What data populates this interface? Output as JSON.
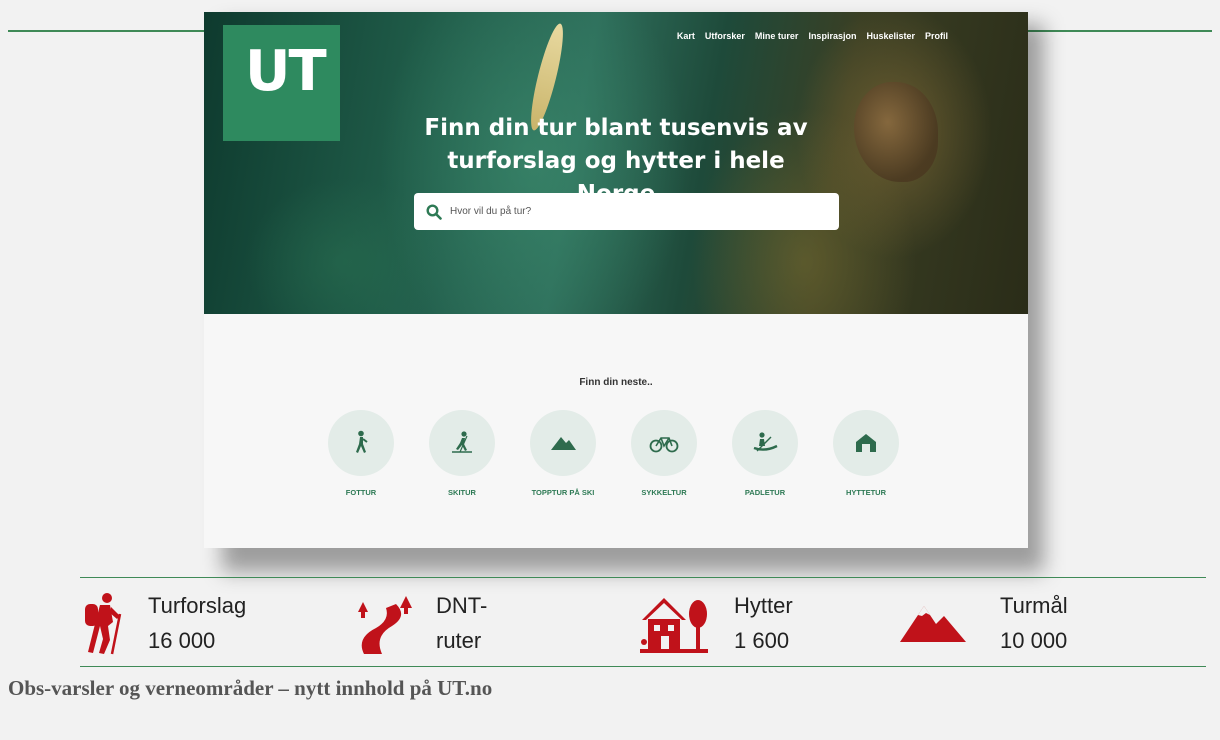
{
  "logo_text": "UT",
  "nav": [
    "Kart",
    "Utforsker",
    "Mine turer",
    "Inspirasjon",
    "Huskelister",
    "Profil"
  ],
  "hero": {
    "title_line1": "Finn din tur blant tusenvis av",
    "title_line2": "turforslag og hytter i hele Norge"
  },
  "search": {
    "placeholder": "Hvor vil du på tur?"
  },
  "finn_heading": "Finn din neste..",
  "categories": [
    {
      "label": "FOTTUR",
      "icon": "hiker-icon"
    },
    {
      "label": "SKITUR",
      "icon": "skier-icon"
    },
    {
      "label": "TOPPTUR PÅ SKI",
      "icon": "mountain-icon"
    },
    {
      "label": "SYKKELTUR",
      "icon": "bicycle-icon"
    },
    {
      "label": "PADLETUR",
      "icon": "paddle-icon"
    },
    {
      "label": "HYTTETUR",
      "icon": "cabin-icon"
    }
  ],
  "stats": [
    {
      "line1": "Turforslag",
      "line2": "16 000",
      "icon": "backpacker-icon"
    },
    {
      "line1": "DNT-",
      "line2": "ruter",
      "icon": "trail-icon"
    },
    {
      "line1": "Hytter",
      "line2": "1 600",
      "icon": "cabin-tree-icon"
    },
    {
      "line1": "Turmål",
      "line2": "10 000",
      "icon": "mountain-peak-icon"
    }
  ],
  "article_title": "Obs-varsler og verneområder – nytt innhold på UT.no",
  "colors": {
    "brand_green": "#2e8a5f",
    "stat_red": "#c0121a",
    "line_green": "#3f8a57"
  }
}
